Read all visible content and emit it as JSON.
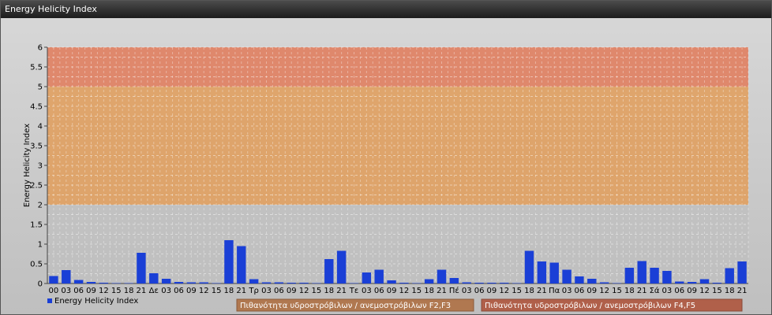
{
  "window": {
    "title": "Energy Helicity Index"
  },
  "colors": {
    "bar": "#1a3fd6",
    "band_low": "#c0c0c0",
    "band_mid": "#e0a060",
    "band_high": "#e08060",
    "box_f2f3": "#b07850",
    "box_f4f5": "#b0604a"
  },
  "probability_boxes": [
    {
      "label": "Πιθανότητα υδροστρόβιλων / ανεμοστρόβιλων F2,F3"
    },
    {
      "label": "Πιθανότητα υδροστρόβιλων / ανεμοστρόβιλων F4,F5"
    }
  ],
  "chart_data": {
    "type": "bar",
    "title": "",
    "ylabel": "Energy Helicity Index",
    "xlabel": "",
    "ylim": [
      0,
      6
    ],
    "yticks": [
      "0",
      "0.5",
      "1",
      "1.5",
      "2",
      "2.5",
      "3",
      "3.5",
      "4",
      "4.5",
      "5",
      "5.5",
      "6"
    ],
    "bands": [
      {
        "from": 0,
        "to": 2,
        "color": "#c0c0c0"
      },
      {
        "from": 2,
        "to": 5,
        "color": "#e0a060"
      },
      {
        "from": 5,
        "to": 6,
        "color": "#e08060"
      }
    ],
    "categories": [
      "00",
      "03",
      "06",
      "09",
      "12",
      "15",
      "18",
      "21",
      "Δε",
      "03",
      "06",
      "09",
      "12",
      "15",
      "18",
      "21",
      "Τρ",
      "03",
      "06",
      "09",
      "12",
      "15",
      "18",
      "21",
      "Τε",
      "03",
      "06",
      "09",
      "12",
      "15",
      "18",
      "21",
      "Πέ",
      "03",
      "06",
      "09",
      "12",
      "15",
      "18",
      "21",
      "Πα",
      "03",
      "06",
      "09",
      "12",
      "15",
      "18",
      "21",
      "Σά",
      "03",
      "06",
      "09",
      "12",
      "15",
      "18",
      "21"
    ],
    "series": [
      {
        "name": "Energy Helicity Index",
        "values": [
          0.19,
          0.34,
          0.09,
          0.04,
          0.02,
          0.01,
          0.01,
          0.78,
          0.26,
          0.12,
          0.04,
          0.03,
          0.03,
          0.01,
          1.1,
          0.95,
          0.11,
          0.03,
          0.03,
          0.02,
          0.02,
          0.01,
          0.62,
          0.83,
          0.01,
          0.28,
          0.35,
          0.08,
          0.02,
          0.01,
          0.11,
          0.35,
          0.14,
          0.03,
          0.02,
          0.02,
          0.02,
          0.01,
          0.83,
          0.56,
          0.53,
          0.35,
          0.18,
          0.12,
          0.03,
          0.01,
          0.4,
          0.57,
          0.4,
          0.32,
          0.05,
          0.04,
          0.11,
          0.02,
          0.39,
          0.56
        ]
      }
    ],
    "legend": {
      "position": "bottom-left"
    }
  }
}
